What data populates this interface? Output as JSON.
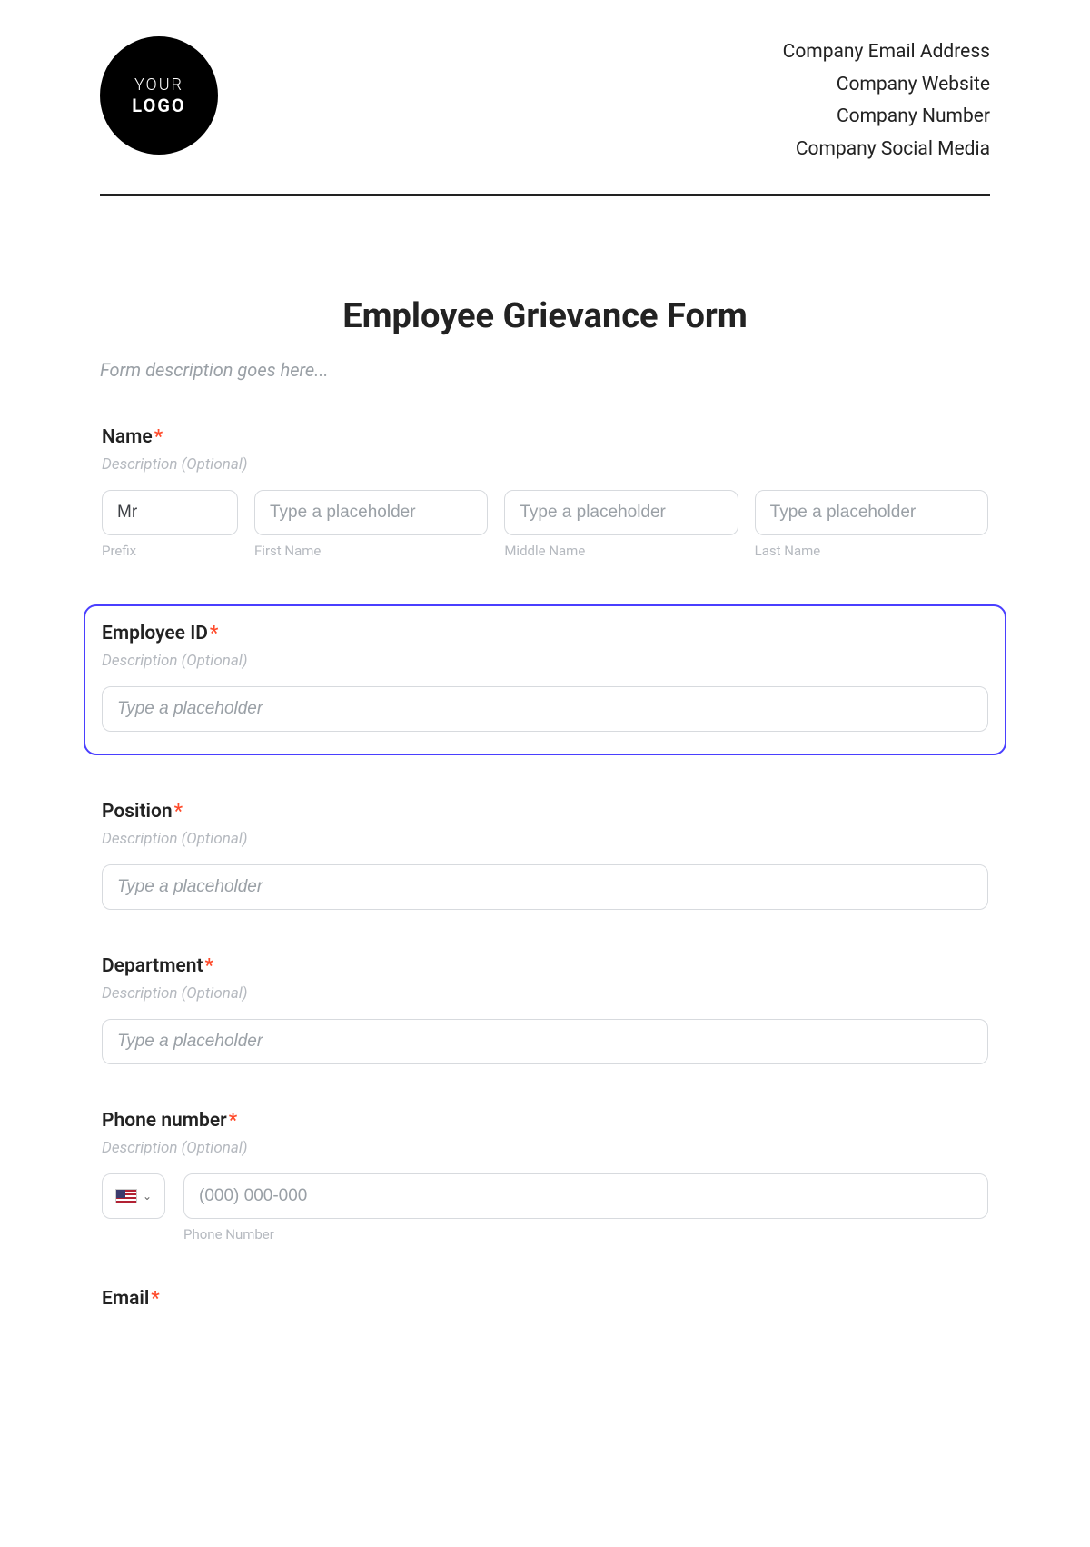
{
  "header": {
    "logo_line1": "YOUR",
    "logo_line2": "LOGO",
    "company": {
      "email": "Company Email Address",
      "website": "Company Website",
      "number": "Company Number",
      "social": "Company Social Media"
    }
  },
  "form": {
    "title": "Employee Grievance Form",
    "description_placeholder": "Form description goes here..."
  },
  "fields": {
    "name": {
      "label": "Name",
      "required_mark": "*",
      "description": "Description (Optional)",
      "prefix": {
        "value": "Mr",
        "sublabel": "Prefix"
      },
      "first": {
        "placeholder": "Type a placeholder",
        "sublabel": "First Name"
      },
      "middle": {
        "placeholder": "Type a placeholder",
        "sublabel": "Middle Name"
      },
      "last": {
        "placeholder": "Type a placeholder",
        "sublabel": "Last Name"
      }
    },
    "employee_id": {
      "label": "Employee ID",
      "required_mark": "*",
      "description": "Description (Optional)",
      "placeholder": "Type a placeholder"
    },
    "position": {
      "label": "Position",
      "required_mark": "*",
      "description": "Description (Optional)",
      "placeholder": "Type a placeholder"
    },
    "department": {
      "label": "Department",
      "required_mark": "*",
      "description": "Description (Optional)",
      "placeholder": "Type a placeholder"
    },
    "phone": {
      "label": "Phone number",
      "required_mark": "*",
      "description": "Description (Optional)",
      "placeholder": "(000) 000-000",
      "sublabel": "Phone Number"
    },
    "email": {
      "label": "Email",
      "required_mark": "*"
    }
  }
}
